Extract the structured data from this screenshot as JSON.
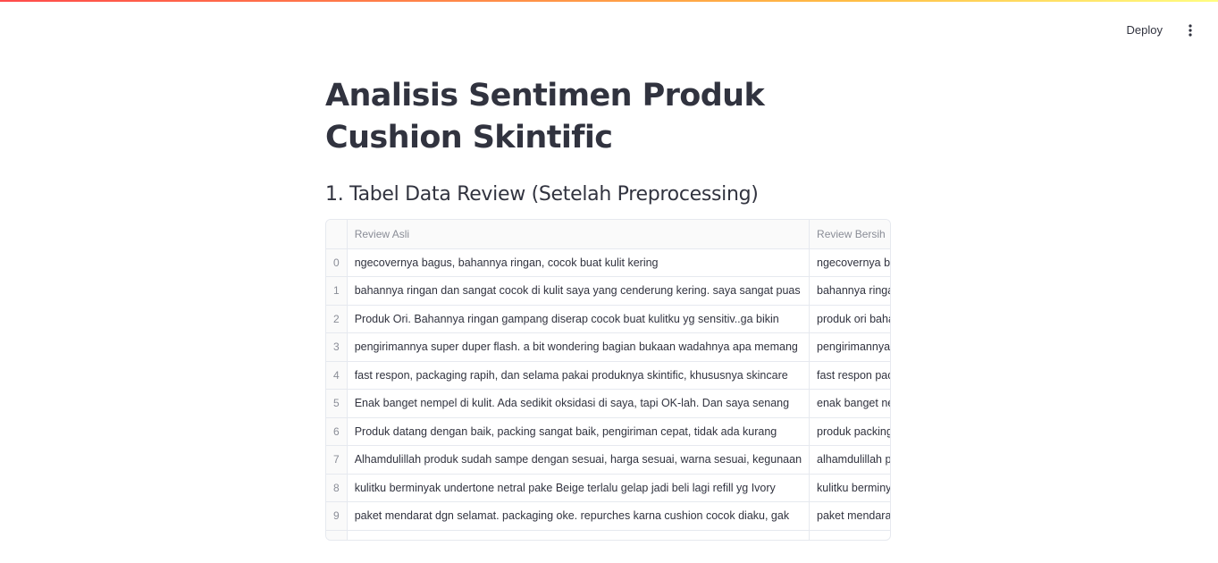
{
  "header": {
    "deploy_label": "Deploy",
    "menu_icon": "kebab-menu-icon"
  },
  "page": {
    "title": "Analisis Sentimen Produk Cushion Skintific",
    "subtitle": "1. Tabel Data Review (Setelah Preprocessing)"
  },
  "colors": {
    "accent_gradient_start": "#ff4b4b",
    "accent_gradient_end": "#fffd80",
    "text": "#31333f",
    "muted": "#8a8d97",
    "border": "#e6e9ef"
  },
  "table": {
    "columns": [
      "",
      "Review Asli",
      "Review Bersih"
    ],
    "rows": [
      {
        "index": "0",
        "asli": "ngecovernya bagus, bahannya ringan, cocok buat kulit kering",
        "bersih": "ngecovernya bagus bahannya ringan cocok buat kulit kering"
      },
      {
        "index": "1",
        "asli": "bahannya ringan dan sangat cocok di kulit saya yang cenderung kering. saya sangat puas",
        "bersih": "bahannya ringan cocok kulit cenderung kering puas"
      },
      {
        "index": "2",
        "asli": "Produk Ori. Bahannya ringan gampang diserap cocok buat kulitku yg sensitiv..ga bikin",
        "bersih": "produk ori bahannya ringan gampang diserap cocok"
      },
      {
        "index": "3",
        "asli": "pengirimannya super duper flash. a bit wondering bagian bukaan wadahnya apa memang",
        "bersih": "pengirimannya super duper flash bit wondering"
      },
      {
        "index": "4",
        "asli": "fast respon, packaging rapih, dan selama pakai produknya skintific, khususnya skincare",
        "bersih": "fast respon packaging rapih pakai produknya"
      },
      {
        "index": "5",
        "asli": "Enak banget nempel di kulit.  Ada sedikit oksidasi di saya, tapi OK-lah. Dan saya senang",
        "bersih": "enak banget nempel kulit sedikit oksidasi"
      },
      {
        "index": "6",
        "asli": "Produk datang dengan baik, packing sangat baik, pengiriman cepat, tidak ada kurang",
        "bersih": "produk packing pengiriman cepat kurang"
      },
      {
        "index": "7",
        "asli": "Alhamdulillah produk sudah sampe dengan sesuai, harga sesuai, warna sesuai, kegunaan",
        "bersih": "alhamdulillah produk sampe sesuai harga"
      },
      {
        "index": "8",
        "asli": "kulitku berminyak undertone netral  pake Beige terlalu gelap jadi beli lagi refill yg Ivory",
        "bersih": "kulitku berminyak undertone netral pake beige"
      },
      {
        "index": "9",
        "asli": "paket mendarat dgn selamat. packaging oke. repurches karna cushion cocok diaku, gak",
        "bersih": "paket mendarat dgn selamat packaging oke"
      }
    ]
  }
}
